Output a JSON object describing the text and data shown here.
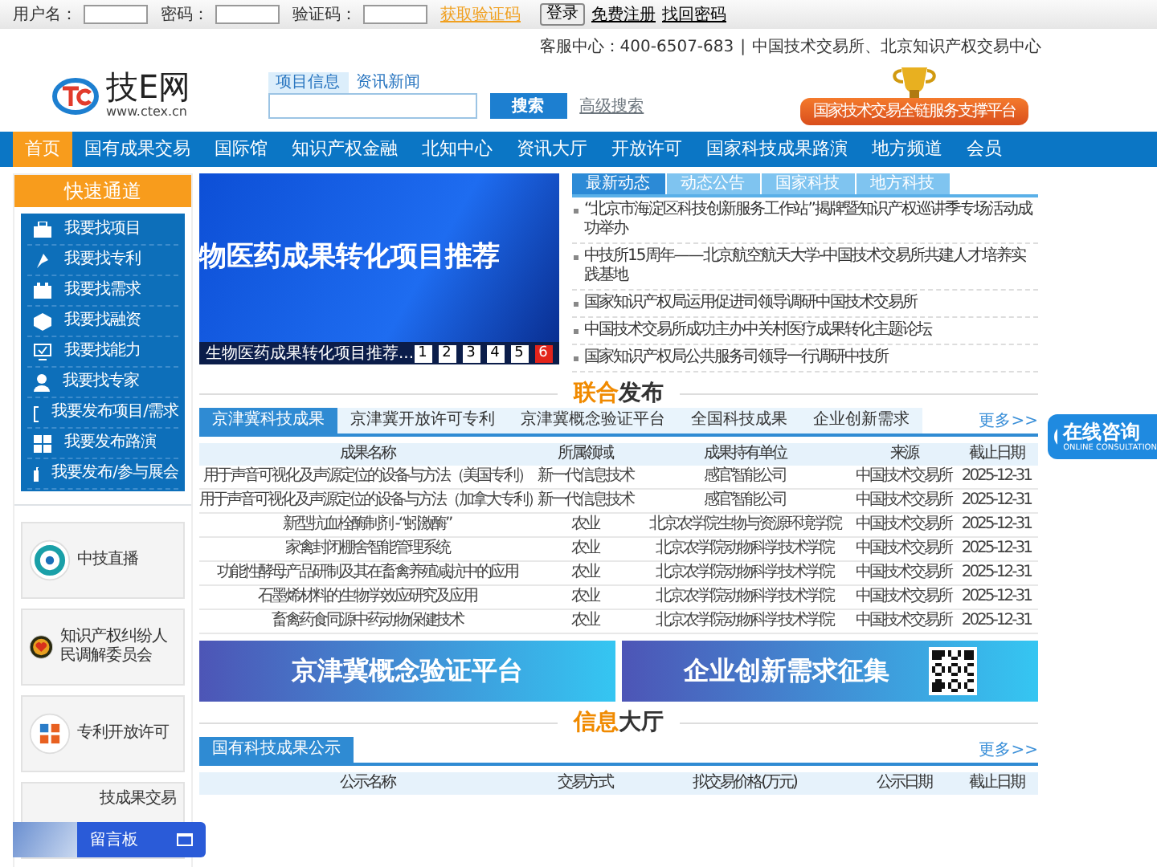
{
  "top_bar": {
    "fields": [
      {
        "label": "用户名："
      },
      {
        "label": "密码："
      },
      {
        "label": "验证码："
      }
    ],
    "captcha_link": "获取验证码",
    "login_button": "登录",
    "links": [
      "免费注册",
      "找回密码"
    ]
  },
  "header": {
    "service": "客服中心：400-6507-683",
    "separator": "|",
    "orgs": "中国技术交易所、北京知识产权交易中心",
    "logo": {
      "name": "技E网",
      "url": "www.ctex.cn"
    },
    "search": {
      "tabs": [
        {
          "label": "项目信息",
          "selected": true
        },
        {
          "label": "资讯新闻",
          "selected": false
        }
      ],
      "button": "搜索",
      "advanced": "高级搜索"
    },
    "award": "国家技术交易全链服务支撑平台"
  },
  "nav": [
    {
      "label": "首页",
      "selected": true
    },
    {
      "label": "国有成果交易",
      "selected": false
    },
    {
      "label": "国际馆",
      "selected": false
    },
    {
      "label": "知识产权金融",
      "selected": false
    },
    {
      "label": "北知中心",
      "selected": false
    },
    {
      "label": "资讯大厅",
      "selected": false
    },
    {
      "label": "开放许可",
      "selected": false
    },
    {
      "label": "国家科技成果路演",
      "selected": false
    },
    {
      "label": "地方频道",
      "selected": false
    },
    {
      "label": "会员",
      "selected": false
    }
  ],
  "sidebar": {
    "title": "快速通道",
    "items": [
      "我要找项目",
      "我要找专利",
      "我要找需求",
      "我要找融资",
      "我要找能力",
      "我要找专家",
      "我要发布项目/需求",
      "我要发布路演",
      "我要发布/参与展会"
    ],
    "cards": [
      "中技直播",
      "知识产权纠纷人民调解委员会",
      "专利开放许可",
      "技成果交易"
    ]
  },
  "slider": {
    "headline": "物医药成果转化项目推荐",
    "caption": "生物医药成果转化项目推荐...",
    "pages": [
      {
        "label": "1",
        "selected": false
      },
      {
        "label": "2",
        "selected": false
      },
      {
        "label": "3",
        "selected": false
      },
      {
        "label": "4",
        "selected": false
      },
      {
        "label": "5",
        "selected": false
      },
      {
        "label": "6",
        "selected": true
      }
    ]
  },
  "news": {
    "tabs": [
      {
        "label": "最新动态",
        "selected": true
      },
      {
        "label": "动态公告",
        "selected": false
      },
      {
        "label": "国家科技",
        "selected": false
      },
      {
        "label": "地方科技",
        "selected": false
      }
    ],
    "items": [
      "“北京市海淀区科技创新服务工作站”揭牌暨知识产权巡讲季专场活动成功举办",
      "中技所15周年——北京航空航天大学-中国技术交易所共建人才培养实践基地",
      "国家知识产权局运用促进司领导调研中国技术交易所",
      "中国技术交易所成功主办中关村医疗成果转化主题论坛",
      "国家知识产权局公共服务司领导一行调研中技所"
    ]
  },
  "joint": {
    "heading": {
      "highlight": "联合",
      "rest": "发布"
    },
    "tabs": [
      {
        "label": "京津冀科技成果",
        "selected": true
      },
      {
        "label": "京津冀开放许可专利",
        "selected": false
      },
      {
        "label": "京津冀概念验证平台",
        "selected": false
      },
      {
        "label": "全国科技成果",
        "selected": false
      },
      {
        "label": "企业创新需求",
        "selected": false
      }
    ],
    "more": "更多>>",
    "columns": [
      "成果名称",
      "所属领域",
      "成果持有单位",
      "来源",
      "截止日期"
    ],
    "rows": [
      [
        "用于声音可视化及声源定位的设备与方法（美国专利）",
        "新一代信息技术",
        "感官智能公司",
        "中国技术交易所",
        "2025-12-31"
      ],
      [
        "用于声音可视化及声源定位的设备与方法（加拿大专利）",
        "新一代信息技术",
        "感官智能公司",
        "中国技术交易所",
        "2025-12-31"
      ],
      [
        "新型抗血栓酶制剂 -“蚓激酶”",
        "农业",
        "北京农学院生物与资源环境学院",
        "中国技术交易所",
        "2025-12-31"
      ],
      [
        "家禽封闭棚舍智能管理系统",
        "农业",
        "北京农学院动物科学技术学院",
        "中国技术交易所",
        "2025-12-31"
      ],
      [
        "功能性酵母产品研制及其在畜禽养殖减抗中的应用",
        "农业",
        "北京农学院动物科学技术学院",
        "中国技术交易所",
        "2025-12-31"
      ],
      [
        "石墨烯材料的生物学效应研究及应用",
        "农业",
        "北京农学院动物科学技术学院",
        "中国技术交易所",
        "2025-12-31"
      ],
      [
        "畜禽药食同源中药动物保健技术",
        "农业",
        "北京农学院动物科学技术学院",
        "中国技术交易所",
        "2025-12-31"
      ]
    ]
  },
  "promos": [
    {
      "title": "京津冀概念验证平台",
      "qr": false
    },
    {
      "title": "企业创新需求征集",
      "qr": true
    }
  ],
  "hall": {
    "heading": {
      "highlight": "信息",
      "rest": "大厅"
    },
    "tabs": [
      {
        "label": "国有科技成果公示",
        "selected": true
      }
    ],
    "more": "更多>>",
    "columns": [
      "公示名称",
      "交易方式",
      "拟交易价格(万元)",
      "公示日期",
      "截止日期"
    ]
  },
  "widgets": {
    "message_board": "留言板",
    "consult": {
      "title": "在线咨询",
      "subtitle": "ONLINE CONSULTATION"
    }
  }
}
